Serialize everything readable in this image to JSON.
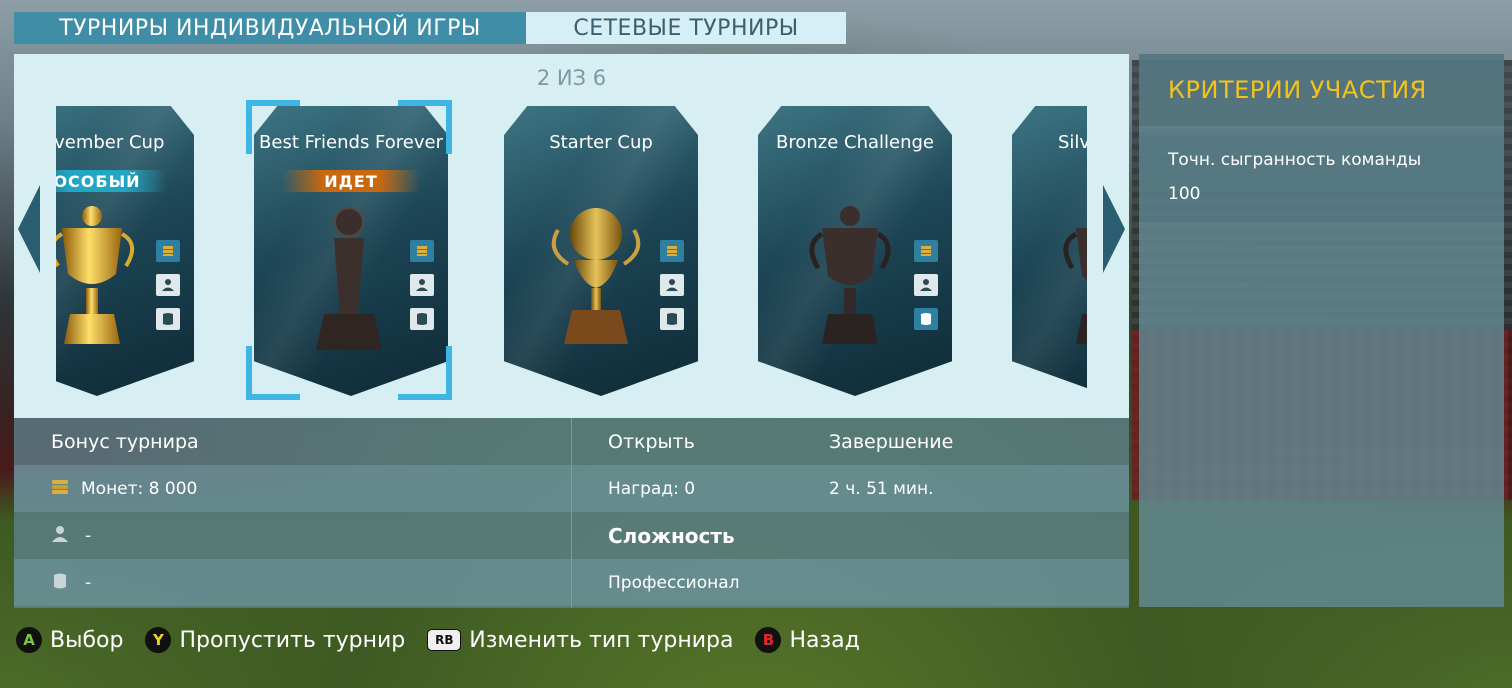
{
  "tabs": [
    {
      "label": "ТУРНИРЫ ИНДИВИДУАЛЬНОЙ ИГРЫ",
      "active": true
    },
    {
      "label": "СЕТЕВЫЕ ТУРНИРЫ",
      "active": false
    }
  ],
  "carousel": {
    "counter": "2 ИЗ 6",
    "cards": [
      {
        "title": "November Cup",
        "badge": "ОСОБЫЙ",
        "trophy": "gold-cup"
      },
      {
        "title": "Best Friends Forever",
        "badge": "ИДЕТ",
        "trophy": "dark-tower"
      },
      {
        "title": "Starter Cup",
        "badge": "",
        "trophy": "gold-ball-cup"
      },
      {
        "title": "Bronze Challenge",
        "badge": "",
        "trophy": "dark-cup"
      },
      {
        "title": "Silver",
        "badge": "",
        "trophy": "dark-cup"
      }
    ]
  },
  "details": {
    "bonus_header": "Бонус турнира",
    "bonus_coins": "Монет: 8 000",
    "bonus_player": "-",
    "bonus_kit": "-",
    "open_header": "Открыть",
    "open_value": "Наград: 0",
    "end_header": "Завершение",
    "end_value": "2 ч. 51 мин.",
    "difficulty_header": "Сложность",
    "difficulty_value": "Профессионал"
  },
  "criteria": {
    "title": "КРИТЕРИИ УЧАСТИЯ",
    "label": "Точн. сыгранность команды",
    "value": "100"
  },
  "footer": [
    {
      "button": "A",
      "label": "Выбор"
    },
    {
      "button": "Y",
      "label": "Пропустить турнир"
    },
    {
      "button": "RB",
      "label": "Изменить тип турнира"
    },
    {
      "button": "B",
      "label": "Назад"
    }
  ],
  "colors": {
    "accent": "#3f8da6",
    "criteria_title": "#f4c21a",
    "badge_special": "#22a6c4",
    "badge_ongoing": "#c9690f",
    "selection": "#3fb5e6"
  }
}
